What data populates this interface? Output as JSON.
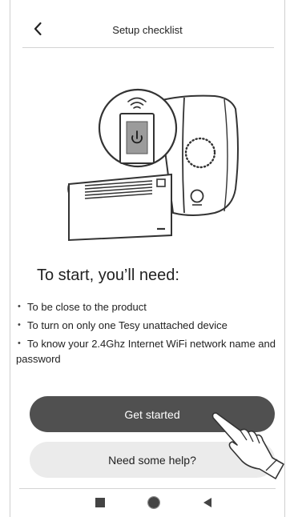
{
  "header": {
    "title": "Setup checklist",
    "back_icon": "chevron-left-icon"
  },
  "illustration": {
    "description_icons": [
      "router-icon",
      "wifi-icon",
      "power-icon",
      "heater-icon"
    ]
  },
  "content": {
    "headline": "To start, you’ll need:",
    "requirements": [
      "To be close to the product",
      "To turn on only one Tesy unattached device",
      "To know your 2.4Ghz Internet WiFi network name and password"
    ]
  },
  "actions": {
    "primary_label": "Get started",
    "secondary_label": "Need some help?"
  },
  "navbar": {
    "icons": [
      "recents-square-icon",
      "home-circle-icon",
      "back-triangle-icon"
    ]
  },
  "colors": {
    "primary_button": "#505050",
    "secondary_button": "#ebebeb",
    "text": "#222222"
  }
}
